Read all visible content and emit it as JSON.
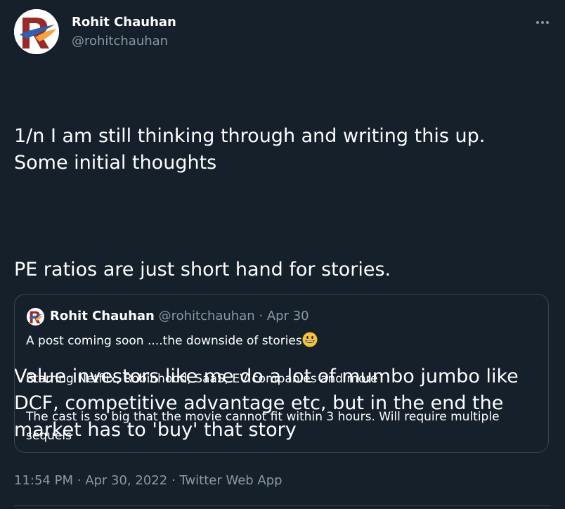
{
  "author": {
    "name": "Rohit Chauhan",
    "handle": "@rohitchauhan"
  },
  "tweet": {
    "paragraphs": [
      "1/n I am still thinking through and writing this up.\nSome initial thoughts",
      "PE ratios are just short hand for stories.",
      "Value investors like me do a lot of mumbo jumbo like DCF, competitive advantage etc, but in the end the market has to 'buy' that story"
    ]
  },
  "quoted_tweet": {
    "name": "Rohit Chauhan",
    "handle": "@rohitchauhan",
    "separator": "·",
    "date": "Apr 30",
    "line1": "A post coming soon ....the downside of stories",
    "line1_emoji": "grinning-face-emoji",
    "line2": "Starring Netflix, Robinhood, SaaS, EV companies and more",
    "line3": "The cast is so big that the movie cannot fit within 3 hours. Will require multiple sequels"
  },
  "meta": {
    "time": "11:54 PM",
    "separator": "·",
    "date": "Apr 30, 2022",
    "source": "Twitter Web App"
  },
  "icons": {
    "more": "more-horizontal-icon"
  },
  "colors": {
    "background": "#15202b",
    "text": "#ffffff",
    "secondary_text": "#8b98a5",
    "border": "#38444d",
    "avatar_red": "#9b2a26",
    "avatar_blue": "#2b5fb8",
    "avatar_orange": "#f2a33a"
  }
}
